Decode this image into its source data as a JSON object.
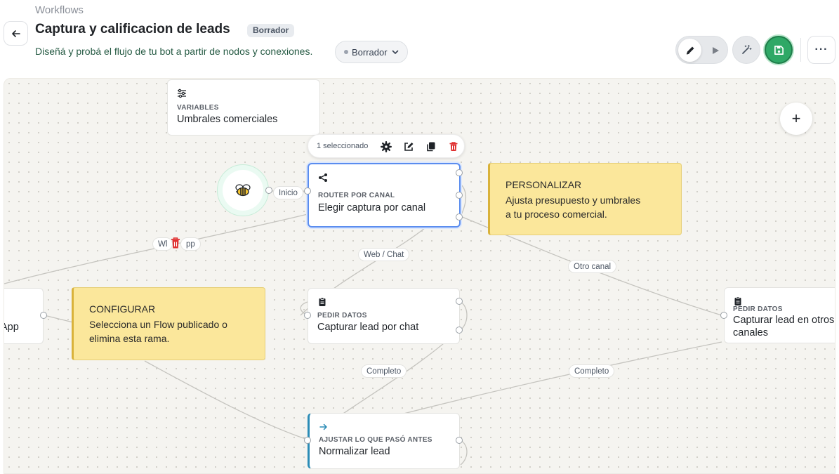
{
  "header": {
    "breadcrumb": "Workflows",
    "title": "Captura y calificacion de leads",
    "status_badge": "Borrador",
    "subtitle": "Diseñá y probá el flujo de tu bot a partir de nodos y conexiones.",
    "status_select": "Borrador",
    "more_label": "···"
  },
  "toolbar": {
    "selection_count": "1 seleccionado"
  },
  "canvas": {
    "add_label": "+",
    "nodes": {
      "variables": {
        "type": "VARIABLES",
        "label": "Umbrales comerciales"
      },
      "router": {
        "type": "ROUTER POR CANAL",
        "label": "Elegir captura por canal"
      },
      "pedir_chat": {
        "type": "PEDIR DATOS",
        "label": "Capturar lead por chat"
      },
      "pedir_otros": {
        "type": "PEDIR DATOS",
        "label_line1": "Capturar lead en otros",
        "label_line2": "canales"
      },
      "ajustar": {
        "type": "AJUSTAR LO QUE PASÓ ANTES",
        "label": "Normalizar lead"
      },
      "app_partial": {
        "label": "App"
      }
    },
    "notes": {
      "personalizar": {
        "heading": "PERSONALIZAR",
        "line1": "Ajusta presupuesto y umbrales",
        "line2": "a tu proceso comercial."
      },
      "configurar": {
        "heading": "CONFIGURAR",
        "line1": "Selecciona un Flow publicado o",
        "line2": "elimina esta rama."
      }
    },
    "edge_labels": {
      "inicio": "Inicio",
      "whatsapp_left": "Wl",
      "whatsapp_right": "pp",
      "web_chat": "Web / Chat",
      "otro_canal": "Otro canal",
      "completo_1": "Completo",
      "completo_2": "Completo"
    }
  },
  "colors": {
    "accent_blue": "#5b8def",
    "save_green": "#2fa866",
    "note_yellow": "#fbe79b",
    "delete_red": "#e03131"
  },
  "icons": [
    "back-arrow-icon",
    "chevron-down-icon",
    "pencil-icon",
    "play-icon",
    "magic-wand-icon",
    "save-icon",
    "gear-icon",
    "edit-icon",
    "duplicate-icon",
    "trash-icon",
    "bee-icon",
    "share-icon",
    "sliders-icon",
    "clipboard-icon",
    "arrow-right-icon"
  ]
}
